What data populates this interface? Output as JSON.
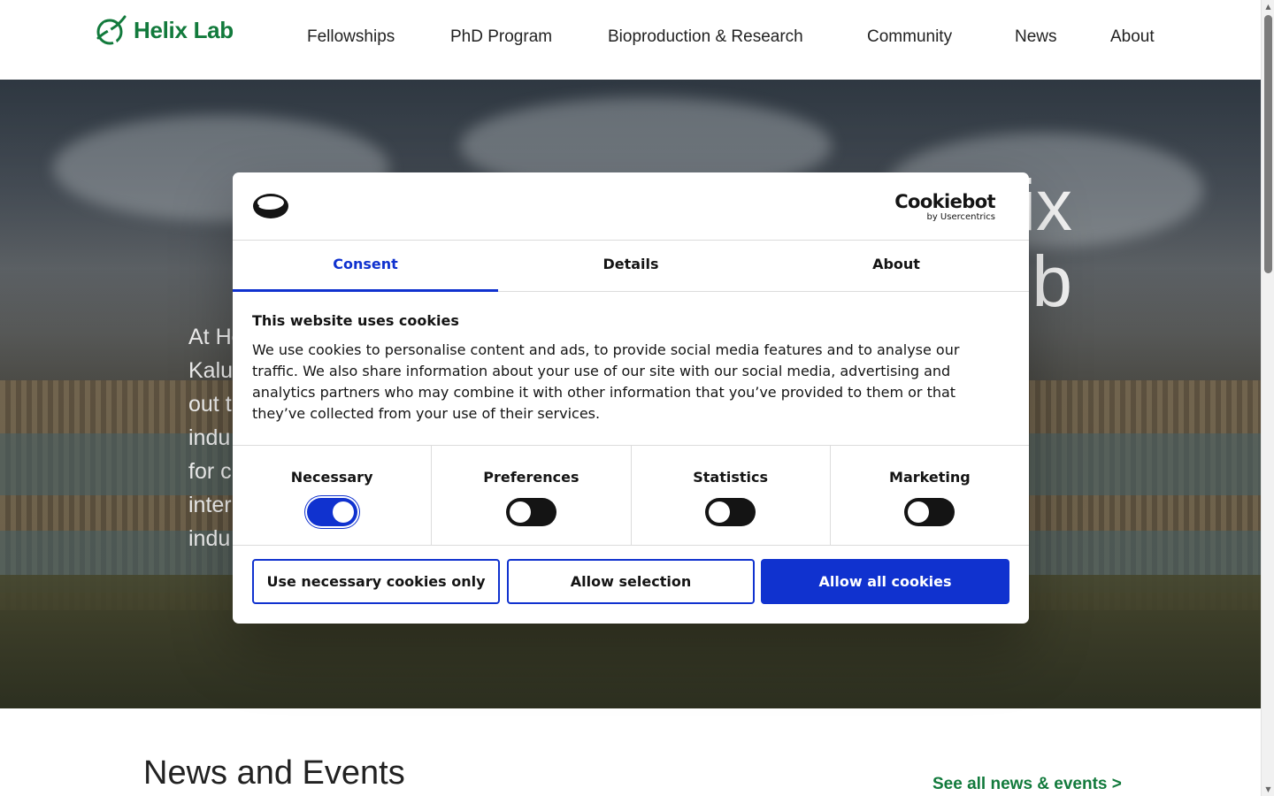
{
  "header": {
    "logo_text": "Helix Lab",
    "nav": [
      {
        "label": "Fellowships"
      },
      {
        "label": "PhD Program"
      },
      {
        "label": "Bioproduction & Research"
      },
      {
        "label": "Community"
      },
      {
        "label": "News"
      },
      {
        "label": "About"
      }
    ]
  },
  "hero": {
    "title_line1": "ix",
    "title_line2": "b",
    "text_lines": [
      "At He",
      "Kalu",
      "out t",
      "indu",
      "for c",
      "inter",
      "indu"
    ]
  },
  "cookie_dialog": {
    "brand": {
      "name": "Cookiebot",
      "sub": "by Usercentrics"
    },
    "tabs": [
      {
        "label": "Consent",
        "active": true
      },
      {
        "label": "Details",
        "active": false
      },
      {
        "label": "About",
        "active": false
      }
    ],
    "heading": "This website uses cookies",
    "paragraph": "We use cookies to personalise content and ads, to provide social media features and to analyse our traffic. We also share information about your use of our site with our social media, advertising and analytics partners who may combine it with other information that you’ve provided to them or that they’ve collected from your use of their services.",
    "categories": [
      {
        "label": "Necessary",
        "enabled": true
      },
      {
        "label": "Preferences",
        "enabled": false
      },
      {
        "label": "Statistics",
        "enabled": false
      },
      {
        "label": "Marketing",
        "enabled": false
      }
    ],
    "buttons": {
      "necessary_only": "Use necessary cookies only",
      "allow_selection": "Allow selection",
      "allow_all": "Allow all cookies"
    },
    "colors": {
      "accent": "#1032cf"
    }
  },
  "news": {
    "heading": "News and Events",
    "see_all": "See all news & events >"
  },
  "colors": {
    "brand_green": "#127a3c"
  }
}
